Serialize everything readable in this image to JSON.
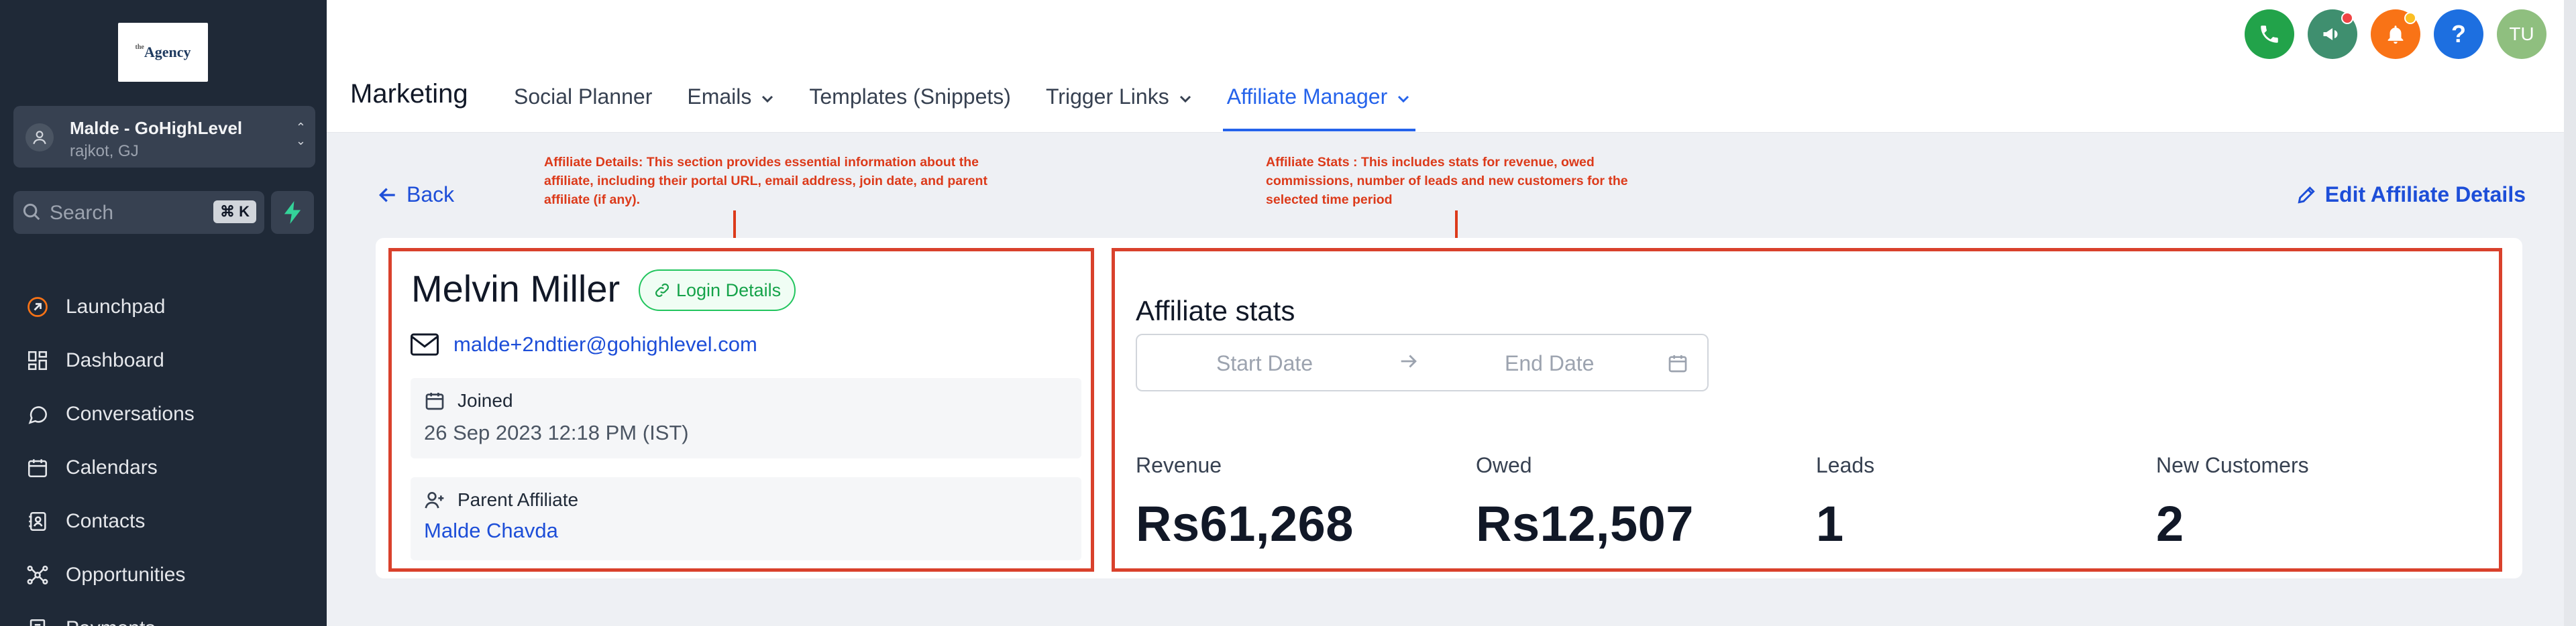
{
  "sidebar": {
    "logo_text": "Agency",
    "logo_prefix": "the",
    "location_name": "Malde - GoHighLevel",
    "location_sub": "rajkot, GJ",
    "search_placeholder": "Search",
    "search_shortcut": "⌘ K",
    "items": [
      {
        "label": "Launchpad",
        "icon": "rocket-icon"
      },
      {
        "label": "Dashboard",
        "icon": "grid-icon"
      },
      {
        "label": "Conversations",
        "icon": "chat-icon"
      },
      {
        "label": "Calendars",
        "icon": "calendar-icon"
      },
      {
        "label": "Contacts",
        "icon": "contacts-icon"
      },
      {
        "label": "Opportunities",
        "icon": "network-icon"
      },
      {
        "label": "Payments",
        "icon": "payments-icon"
      }
    ]
  },
  "header": {
    "title": "Marketing",
    "tabs": [
      {
        "label": "Social Planner",
        "dropdown": false
      },
      {
        "label": "Emails",
        "dropdown": true
      },
      {
        "label": "Templates (Snippets)",
        "dropdown": false
      },
      {
        "label": "Trigger Links",
        "dropdown": true
      },
      {
        "label": "Affiliate Manager",
        "dropdown": true,
        "active": true
      }
    ],
    "avatar_initials": "TU",
    "help_glyph": "?"
  },
  "colors": {
    "phone": "#22a34a",
    "megaphone": "#3f8f6f",
    "bell": "#f97316",
    "help": "#1d6fe0",
    "avatar": "#8fbf7f",
    "accent": "#2563eb",
    "annotation": "#dc3a1a"
  },
  "actions": {
    "back": "Back",
    "edit": "Edit Affiliate Details"
  },
  "annotations": {
    "details": "Affiliate Details: This section provides essential information about the affiliate, including their portal URL, email address, join date, and parent affiliate (if any).",
    "stats": "Affiliate Stats : This includes stats for revenue, owed commissions, number of leads and new customers for the selected time period"
  },
  "affiliate": {
    "name": "Melvin Miller",
    "login_details": "Login Details",
    "email": "malde+2ndtier@gohighlevel.com",
    "joined_label": "Joined",
    "joined_value": "26 Sep 2023 12:18 PM (IST)",
    "parent_label": "Parent Affiliate",
    "parent_value": "Malde Chavda"
  },
  "stats": {
    "title": "Affiliate stats",
    "start_placeholder": "Start Date",
    "end_placeholder": "End Date",
    "items": [
      {
        "label": "Revenue",
        "value": "Rs61,268"
      },
      {
        "label": "Owed",
        "value": "Rs12,507"
      },
      {
        "label": "Leads",
        "value": "1"
      },
      {
        "label": "New Customers",
        "value": "2"
      }
    ]
  }
}
